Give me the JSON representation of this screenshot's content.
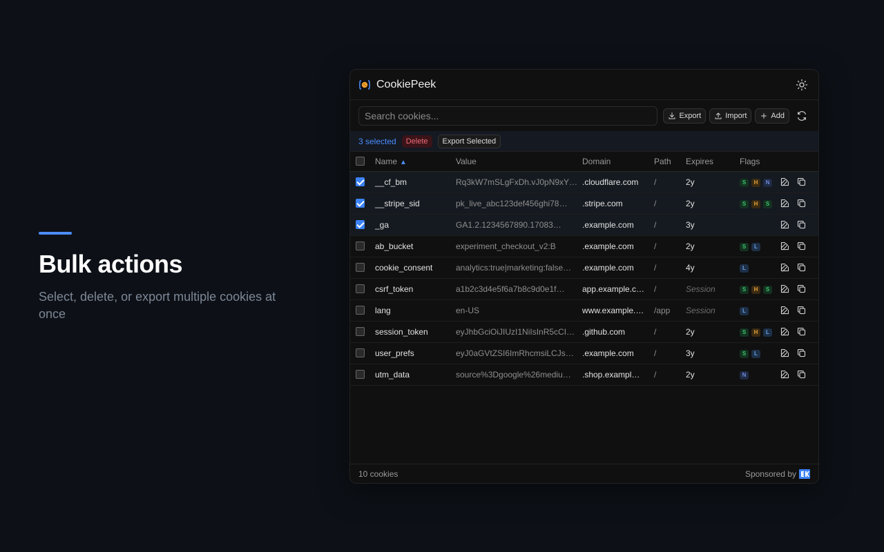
{
  "promo": {
    "title": "Bulk actions",
    "subtitle": "Select, delete, or export multiple cookies at once"
  },
  "app": {
    "title": "CookiePeek",
    "accent_color": "#4c8dff"
  },
  "toolbar": {
    "search_placeholder": "Search cookies...",
    "export_label": "Export",
    "import_label": "Import",
    "add_label": "Add"
  },
  "selection": {
    "count_label": "3 selected",
    "delete_label": "Delete",
    "export_selected_label": "Export Selected"
  },
  "table": {
    "headers": {
      "name": "Name",
      "value": "Value",
      "domain": "Domain",
      "path": "Path",
      "expires": "Expires",
      "flags": "Flags"
    },
    "rows": [
      {
        "selected": true,
        "name": "__cf_bm",
        "value": "Rq3kW7mSLgFxDh.vJ0pN9xY…",
        "domain": ".cloudflare.com",
        "path": "/",
        "expires": "2y",
        "session": false,
        "flags": [
          "S",
          "H",
          "N"
        ]
      },
      {
        "selected": true,
        "name": "__stripe_sid",
        "value": "pk_live_abc123def456ghi78…",
        "domain": ".stripe.com",
        "path": "/",
        "expires": "2y",
        "session": false,
        "flags": [
          "S",
          "H",
          "S"
        ]
      },
      {
        "selected": true,
        "name": "_ga",
        "value": "GA1.2.1234567890.17083…",
        "domain": ".example.com",
        "path": "/",
        "expires": "3y",
        "session": false,
        "flags": []
      },
      {
        "selected": false,
        "name": "ab_bucket",
        "value": "experiment_checkout_v2:B",
        "domain": ".example.com",
        "path": "/",
        "expires": "2y",
        "session": false,
        "flags": [
          "S",
          "L"
        ]
      },
      {
        "selected": false,
        "name": "cookie_consent",
        "value": "analytics:true|marketing:false…",
        "domain": ".example.com",
        "path": "/",
        "expires": "4y",
        "session": false,
        "flags": [
          "L"
        ]
      },
      {
        "selected": false,
        "name": "csrf_token",
        "value": "a1b2c3d4e5f6a7b8c9d0e1f…",
        "domain": "app.example.c…",
        "path": "/",
        "expires": "Session",
        "session": true,
        "flags": [
          "S",
          "H",
          "S"
        ]
      },
      {
        "selected": false,
        "name": "lang",
        "value": "en-US",
        "domain": "www.example.…",
        "path": "/app",
        "expires": "Session",
        "session": true,
        "flags": [
          "L"
        ]
      },
      {
        "selected": false,
        "name": "session_token",
        "value": "eyJhbGciOiJIUzI1NiIsInR5cCI…",
        "domain": ".github.com",
        "path": "/",
        "expires": "2y",
        "session": false,
        "flags": [
          "S",
          "H",
          "L"
        ]
      },
      {
        "selected": false,
        "name": "user_prefs",
        "value": "eyJ0aGVtZSI6ImRhcmsiLCJs…",
        "domain": ".example.com",
        "path": "/",
        "expires": "3y",
        "session": false,
        "flags": [
          "S",
          "L"
        ]
      },
      {
        "selected": false,
        "name": "utm_data",
        "value": "source%3Dgoogle%26mediu…",
        "domain": ".shop.exampl…",
        "path": "/",
        "expires": "2y",
        "session": false,
        "flags": [
          "N"
        ]
      }
    ]
  },
  "footer": {
    "count_label": "10 cookies",
    "sponsor_label": "Sponsored by"
  }
}
